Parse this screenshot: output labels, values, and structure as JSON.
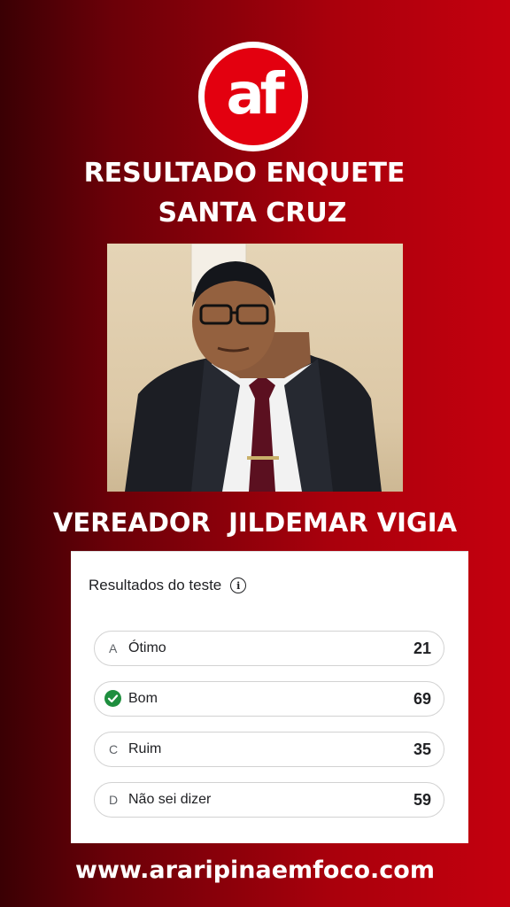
{
  "logo": {
    "text": "af"
  },
  "headline": {
    "line1": "RESULTADO ENQUETE",
    "line2": "SANTA CRUZ"
  },
  "candidate": {
    "name": "VEREADOR  JILDEMAR VIGIA"
  },
  "poll": {
    "title": "Resultados do teste",
    "info_icon": "info-icon",
    "options": [
      {
        "letter": "A",
        "label": "Ótimo",
        "count": "21",
        "selected": false
      },
      {
        "letter": "",
        "label": "Bom",
        "count": "69",
        "selected": true
      },
      {
        "letter": "C",
        "label": "Ruim",
        "count": "35",
        "selected": false
      },
      {
        "letter": "D",
        "label": "Não sei dizer",
        "count": "59",
        "selected": false
      }
    ]
  },
  "footer": {
    "url": "www.araripinaemfoco.com"
  },
  "colors": {
    "brand_red": "#e3000f",
    "check_green": "#1e8e3e"
  }
}
